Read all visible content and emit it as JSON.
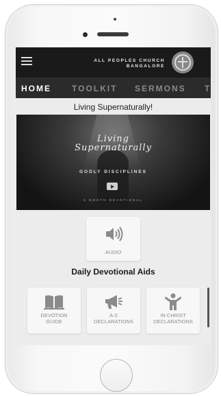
{
  "header": {
    "church_name_line1": "ALL PEOPLES CHURCH",
    "church_name_line2": "BANGALORE"
  },
  "tabs": [
    {
      "label": "HOME",
      "active": true
    },
    {
      "label": "TOOLKIT",
      "active": false
    },
    {
      "label": "SERMONS",
      "active": false
    },
    {
      "label": "T",
      "active": false
    }
  ],
  "page_title": "Living Supernaturally!",
  "banner": {
    "title_line1": "Living",
    "title_line2": "Supernaturally",
    "subtitle": "GODLY DISCIPLINES",
    "footer": "6 MONTH DEVOTIONAL"
  },
  "audio": {
    "label": "AUDIO",
    "icon": "speaker-icon"
  },
  "section_title": "Daily Devotional Aids",
  "aids": [
    {
      "line1": "DEVOTION",
      "line2": "GUIDE",
      "icon": "book-icon"
    },
    {
      "line1": "A-Z",
      "line2": "DECLARATIONS",
      "icon": "megaphone-icon"
    },
    {
      "line1": "IN CHRIST",
      "line2": "DECLARATIONS",
      "icon": "person-icon"
    }
  ],
  "colors": {
    "header_bg": "#1a1a1a",
    "tabs_bg": "#2b2b2b",
    "screen_bg": "#ececec",
    "card_bg": "#f7f7f7"
  }
}
